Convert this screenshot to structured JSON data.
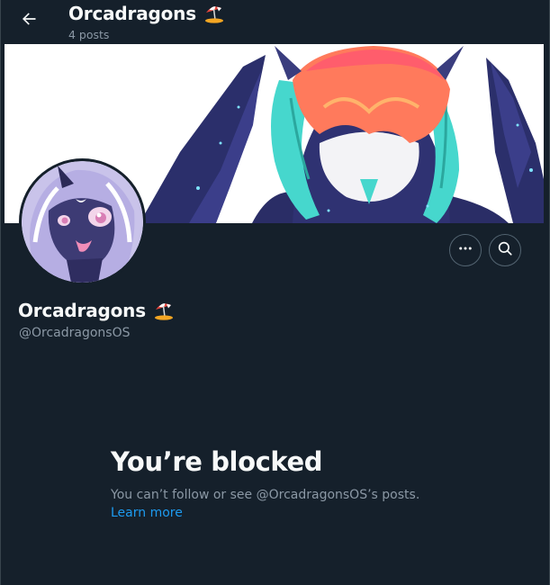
{
  "header": {
    "title": "Orcadragons",
    "posts_count": "4 posts"
  },
  "profile": {
    "display_name": "Orcadragons",
    "handle": "@OrcadragonsOS"
  },
  "blocked": {
    "title": "You’re blocked",
    "description": "You can’t follow or see @OrcadragonsOS’s posts.",
    "learn_more": "Learn more"
  },
  "icons": {
    "back": "arrow-left-icon",
    "more": "more-horizontal-icon",
    "search": "search-icon",
    "emoji": "beach-umbrella-icon"
  },
  "colors": {
    "background": "#15202b",
    "text_primary": "#f7f9f9",
    "text_secondary": "#8b98a5",
    "link": "#1d9bf0",
    "border": "#536471"
  }
}
